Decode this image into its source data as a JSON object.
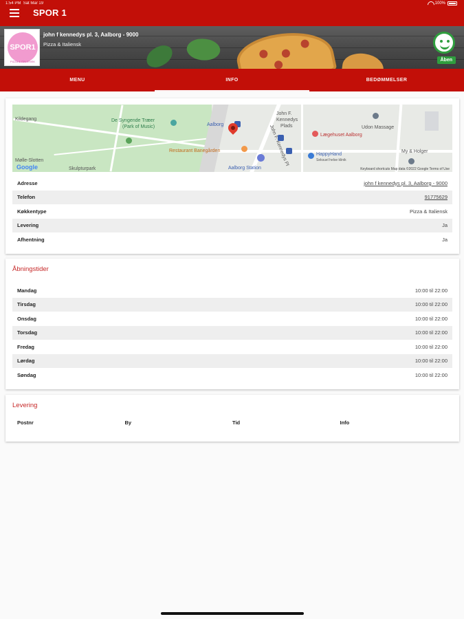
{
  "status_bar": {
    "time": "1:54 PM",
    "date": "Sat Mar 19",
    "battery": "100%"
  },
  "header": {
    "title": "SPOR 1"
  },
  "restaurant": {
    "logo_text": "SPOR1",
    "logo_sub": "PIZZA & ITALIENSK",
    "name": "john f kennedys pl. 3, Aalborg - 9000",
    "type": "Pizza & Italiensk",
    "status": "Åben"
  },
  "tabs": [
    {
      "label": "MENU",
      "active": false
    },
    {
      "label": "INFO",
      "active": true
    },
    {
      "label": "BEDØMMELSER",
      "active": false
    }
  ],
  "map": {
    "labels": {
      "kildegang": "Kildegang",
      "syngende_traer": "De Syngende Træer",
      "park_of_music": "(Park of Music)",
      "aalborg": "Aalborg",
      "jfk_plads_1": "John F.",
      "jfk_plads_2": "Kennedys",
      "jfk_plads_3": "Plads",
      "jfk_street": "John F. Kennedys Pl",
      "udon": "Udon Massage",
      "laegehuset": "Lægehuset Aalborg",
      "happyhand_1": "HappyHand",
      "happyhand_2": "Seksuel helse klinik",
      "banegaarden": "Restaurant Banegården",
      "station": "Aalborg Station",
      "my_holger": "My & Holger",
      "molleslotten": "Mølle-Slotten",
      "skulpturpark": "Skulpturpark",
      "google": "Google",
      "footer": "Keyboard shortcuts   Map data ©2022 Google   Terms of Use"
    }
  },
  "info": [
    {
      "label": "Adresse",
      "value": "john f kennedys pl. 3, Aalborg - 9000",
      "link": true
    },
    {
      "label": "Telefon",
      "value": "91775629",
      "link": true
    },
    {
      "label": "Køkkentype",
      "value": "Pizza & Italiensk",
      "link": false
    },
    {
      "label": "Levering",
      "value": "Ja",
      "link": false
    },
    {
      "label": "Afhentning",
      "value": "Ja",
      "link": false
    }
  ],
  "opening_hours": {
    "title": "Åbningstider",
    "days": [
      {
        "day": "Mandag",
        "hours": "10:00 til 22:00"
      },
      {
        "day": "Tirsdag",
        "hours": "10:00 til 22:00"
      },
      {
        "day": "Onsdag",
        "hours": "10:00 til 22:00"
      },
      {
        "day": "Torsdag",
        "hours": "10:00 til 22:00"
      },
      {
        "day": "Fredag",
        "hours": "10:00 til 22:00"
      },
      {
        "day": "Lørdag",
        "hours": "10:00 til 22:00"
      },
      {
        "day": "Søndag",
        "hours": "10:00 til 22:00"
      }
    ]
  },
  "delivery": {
    "title": "Levering",
    "columns": [
      "Postnr",
      "By",
      "Tid",
      "Info"
    ]
  },
  "colors": {
    "brand": "#c20f08",
    "open": "#2f9e3e",
    "section_title": "#c62828"
  }
}
